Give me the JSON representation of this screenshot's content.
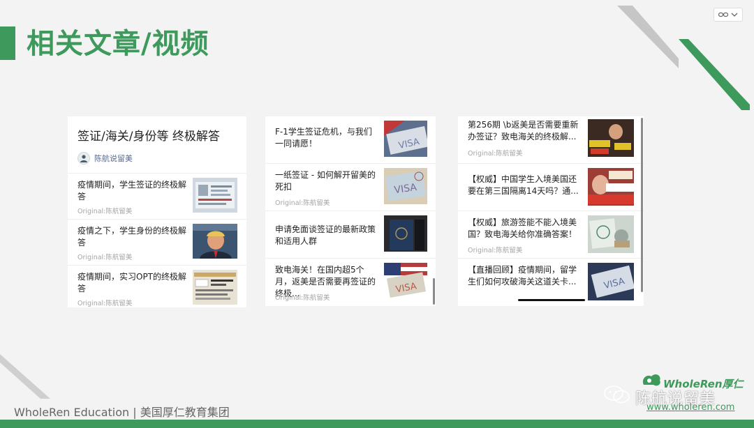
{
  "slide": {
    "title": "相关文章/视频",
    "footer": "WholeRen Education | 美国厚仁教育集团",
    "brand": {
      "logo_text": "WholeRen厚仁",
      "channel_name": "陈航说留美",
      "url": "www.wholeren.com"
    },
    "accent_color": "#3e9a5c"
  },
  "controls": {
    "link_icon": "link-icon",
    "dropdown_icon": "chevron-down-icon"
  },
  "card1": {
    "title": "签证/海关/身份等 终极解答",
    "author": "陈航说留美",
    "items": [
      {
        "title": "疫情期间，学生签证的终极解答",
        "source": "Original:陈航留美",
        "thumb": "visa-document-image"
      },
      {
        "title": "疫情之下，学生身份的终极解答",
        "source": "Original:陈航留美",
        "thumb": "press-conference-image"
      },
      {
        "title": "疫情期间，实习OPT的终极解答",
        "source": "Original:陈航留美",
        "thumb": "opt-form-image"
      }
    ]
  },
  "card2": {
    "items": [
      {
        "title": "F-1学生签证危机，与我们一同请愿！",
        "source": "",
        "thumb": "visa-flag-image"
      },
      {
        "title": "一纸签证 - 如何解开留美的死扣",
        "source": "Original:陈航留美",
        "thumb": "visa-stamp-image"
      },
      {
        "title": "申请免面谈签证的最新政策和适用人群",
        "source": "",
        "thumb": "passport-image"
      },
      {
        "title": "致电海关！在国内超5个月，返美是否需要再签证的终极...",
        "source": "Original:陈航留美",
        "thumb": "visa-flag-image-2"
      }
    ]
  },
  "card3": {
    "items": [
      {
        "title": "第256期 \\b返美是否需要重新办签证？致电海关的终极解...",
        "source": "Original:陈航留美",
        "thumb": "video-thumb-1"
      },
      {
        "title": "【权威】中国学生入境美国还要在第三国隔离14天吗？通...",
        "source": "",
        "thumb": "video-thumb-2"
      },
      {
        "title": "【权威】旅游签能不能入境美国？致电海关给你准确答案！",
        "source": "Original:陈航留美",
        "thumb": "video-thumb-3"
      },
      {
        "title": "【直播回顾】疫情期间，留学生们如何攻破海关这道关卡...",
        "source": "",
        "thumb": "video-thumb-4"
      }
    ]
  }
}
